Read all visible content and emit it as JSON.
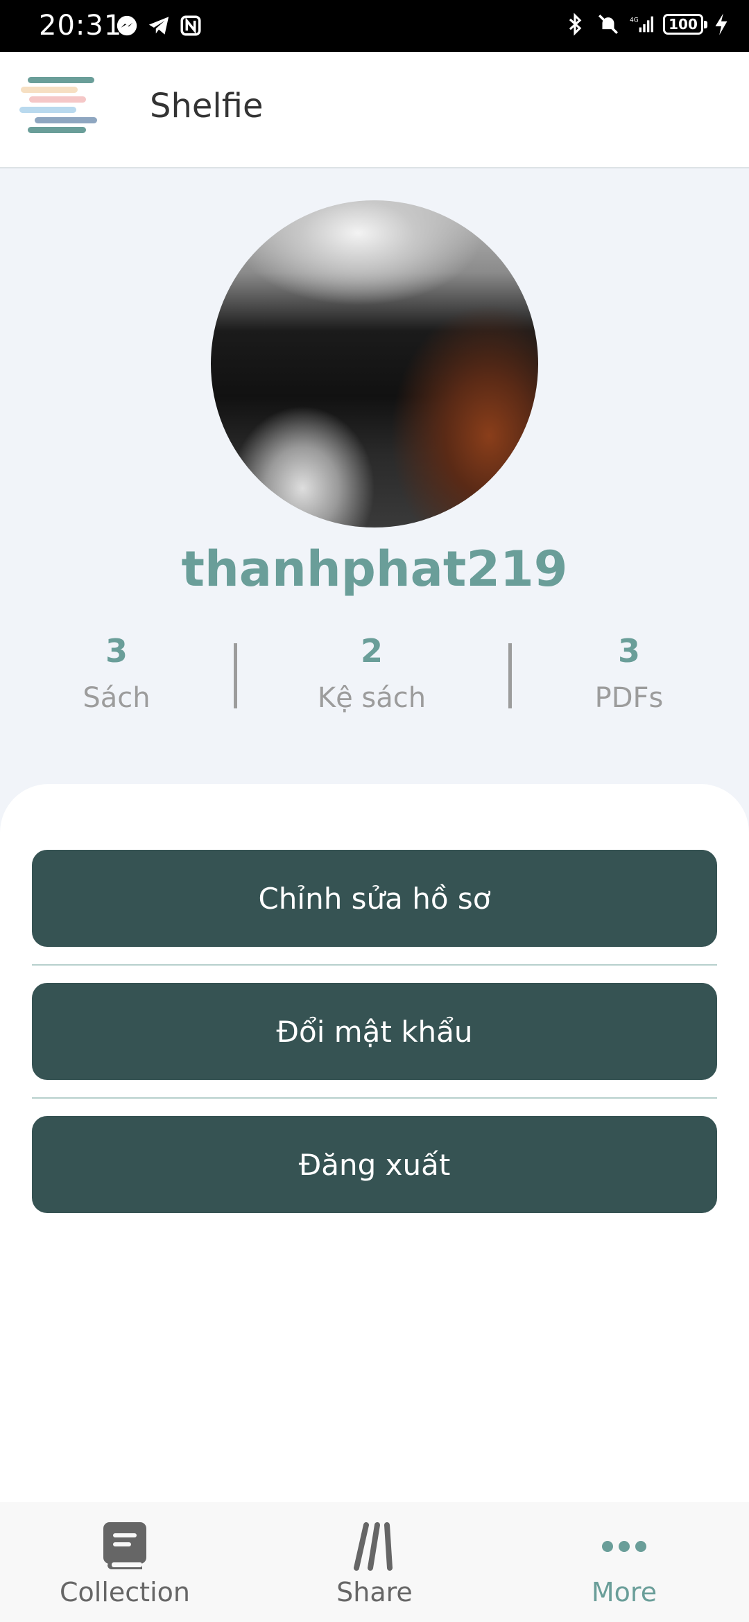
{
  "status_bar": {
    "time": "20:31",
    "battery": "100"
  },
  "header": {
    "title": "Shelfie"
  },
  "profile": {
    "username": "thanhphat219"
  },
  "stats": [
    {
      "value": "3",
      "label": "Sách"
    },
    {
      "value": "2",
      "label": "Kệ sách"
    },
    {
      "value": "3",
      "label": "PDFs"
    }
  ],
  "actions": {
    "edit_profile": "Chỉnh sửa hồ sơ",
    "change_password": "Đổi mật khẩu",
    "logout": "Đăng xuất"
  },
  "nav": {
    "collection": "Collection",
    "share": "Share",
    "more": "More",
    "active": "more"
  },
  "colors": {
    "accent": "#6a9e99",
    "button": "#365353",
    "inactive": "#666666"
  }
}
